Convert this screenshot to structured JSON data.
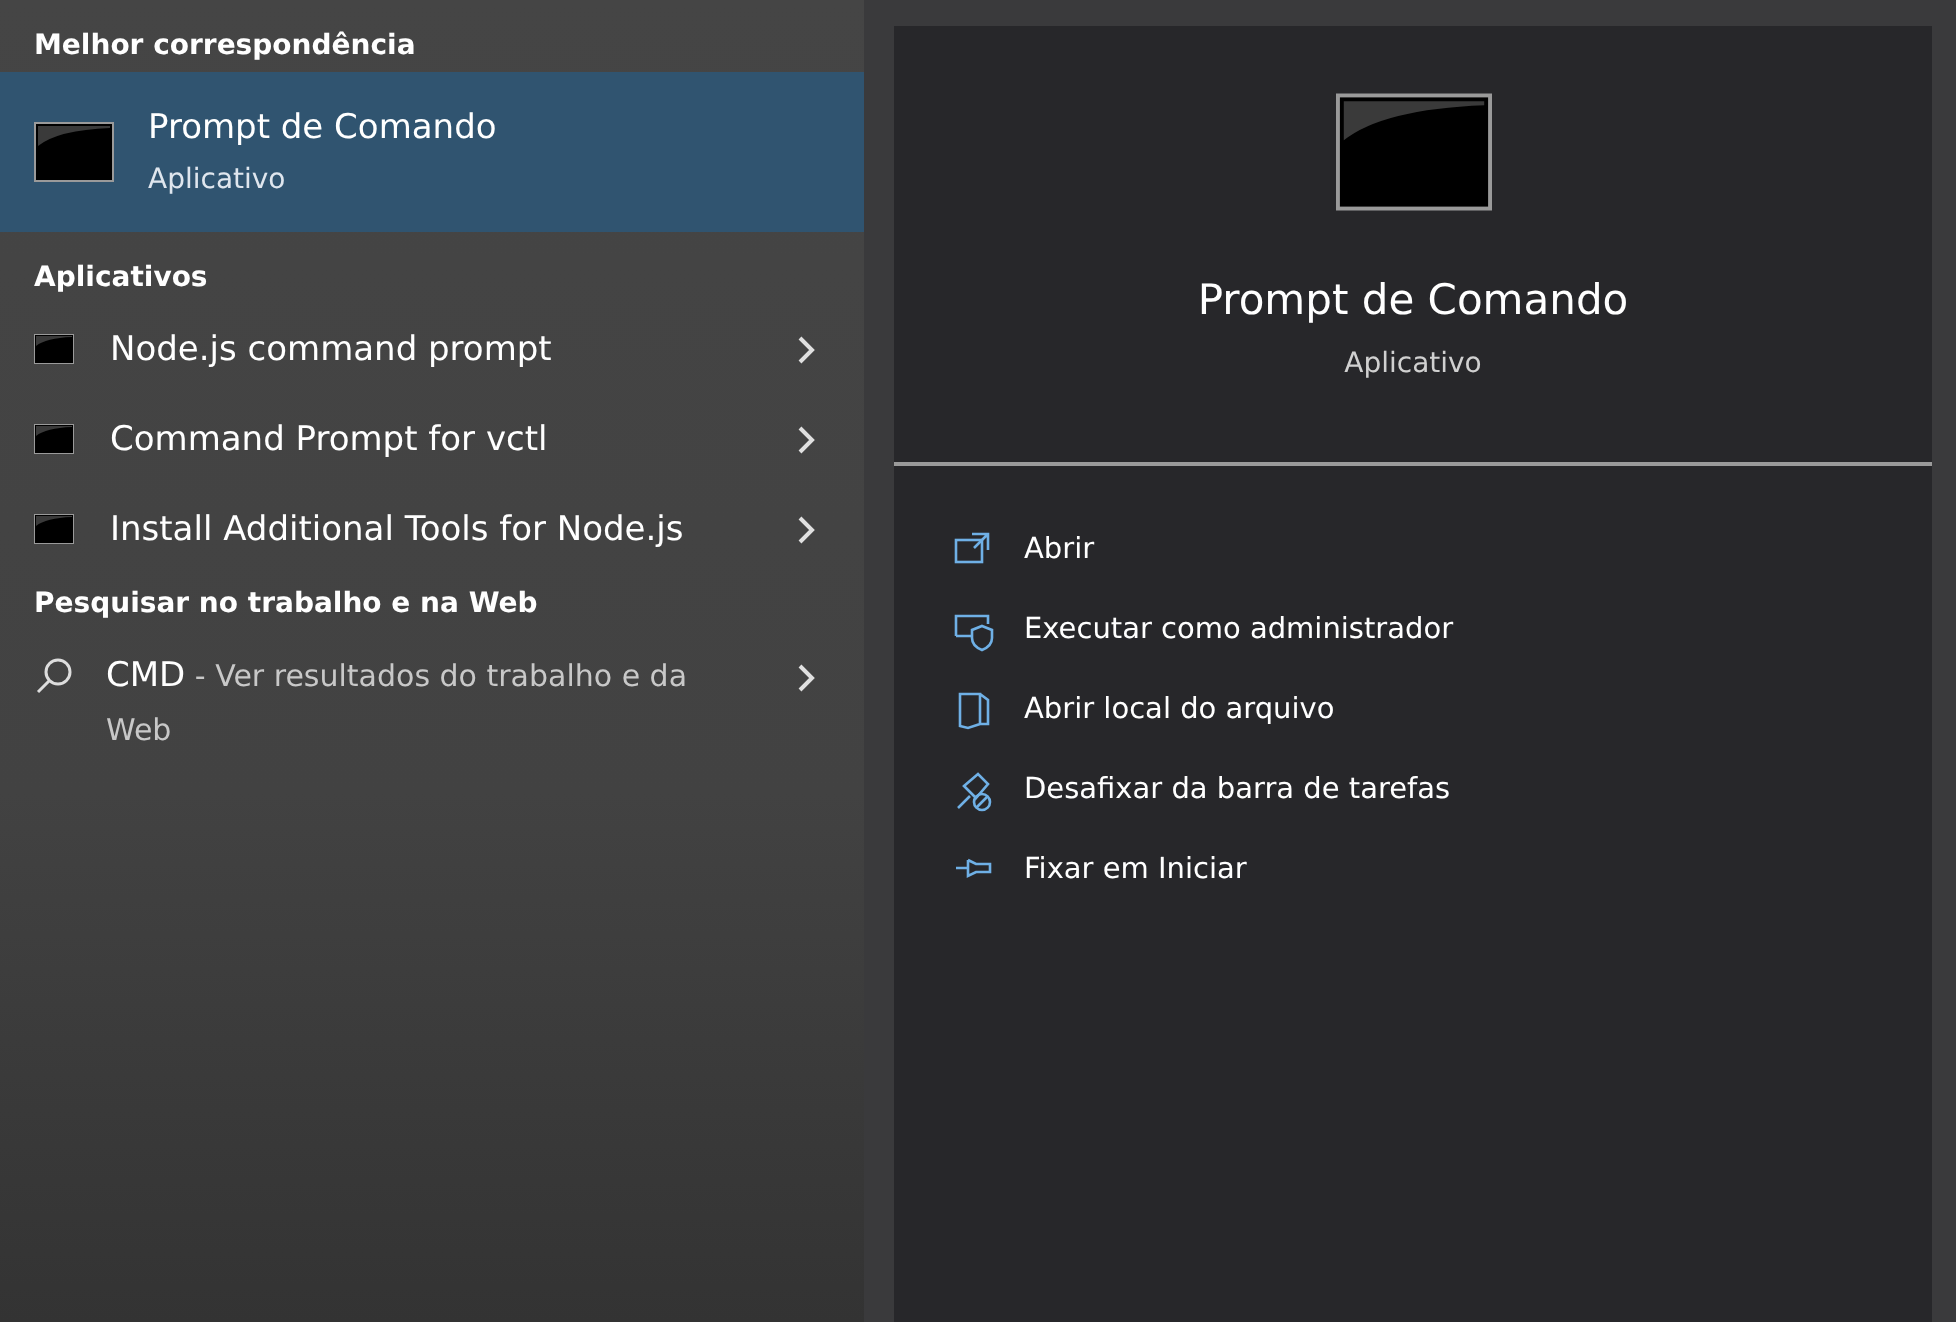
{
  "best_match": {
    "heading": "Melhor correspondência",
    "item": {
      "title": "Prompt de Comando",
      "subtitle": "Aplicativo",
      "selected": true
    }
  },
  "apps": {
    "heading": "Aplicativos",
    "items": [
      {
        "title": "Node.js command prompt",
        "selected": false
      },
      {
        "title": "Command Prompt for vctl",
        "selected": false
      },
      {
        "title": "Install Additional Tools for Node.js",
        "selected": false
      }
    ]
  },
  "web": {
    "heading": "Pesquisar no trabalho e na Web",
    "item": {
      "query": "CMD",
      "suffix": "- Ver resultados do trabalho e da Web",
      "selected": false
    }
  },
  "detail": {
    "title": "Prompt de Comando",
    "subtitle": "Aplicativo",
    "actions": [
      {
        "kind": "open",
        "label": "Abrir"
      },
      {
        "kind": "admin",
        "label": "Executar como administrador"
      },
      {
        "kind": "folder",
        "label": "Abrir local do arquivo"
      },
      {
        "kind": "unpin",
        "label": "Desafixar da barra de tarefas"
      },
      {
        "kind": "pin",
        "label": "Fixar em Iniciar"
      }
    ]
  }
}
